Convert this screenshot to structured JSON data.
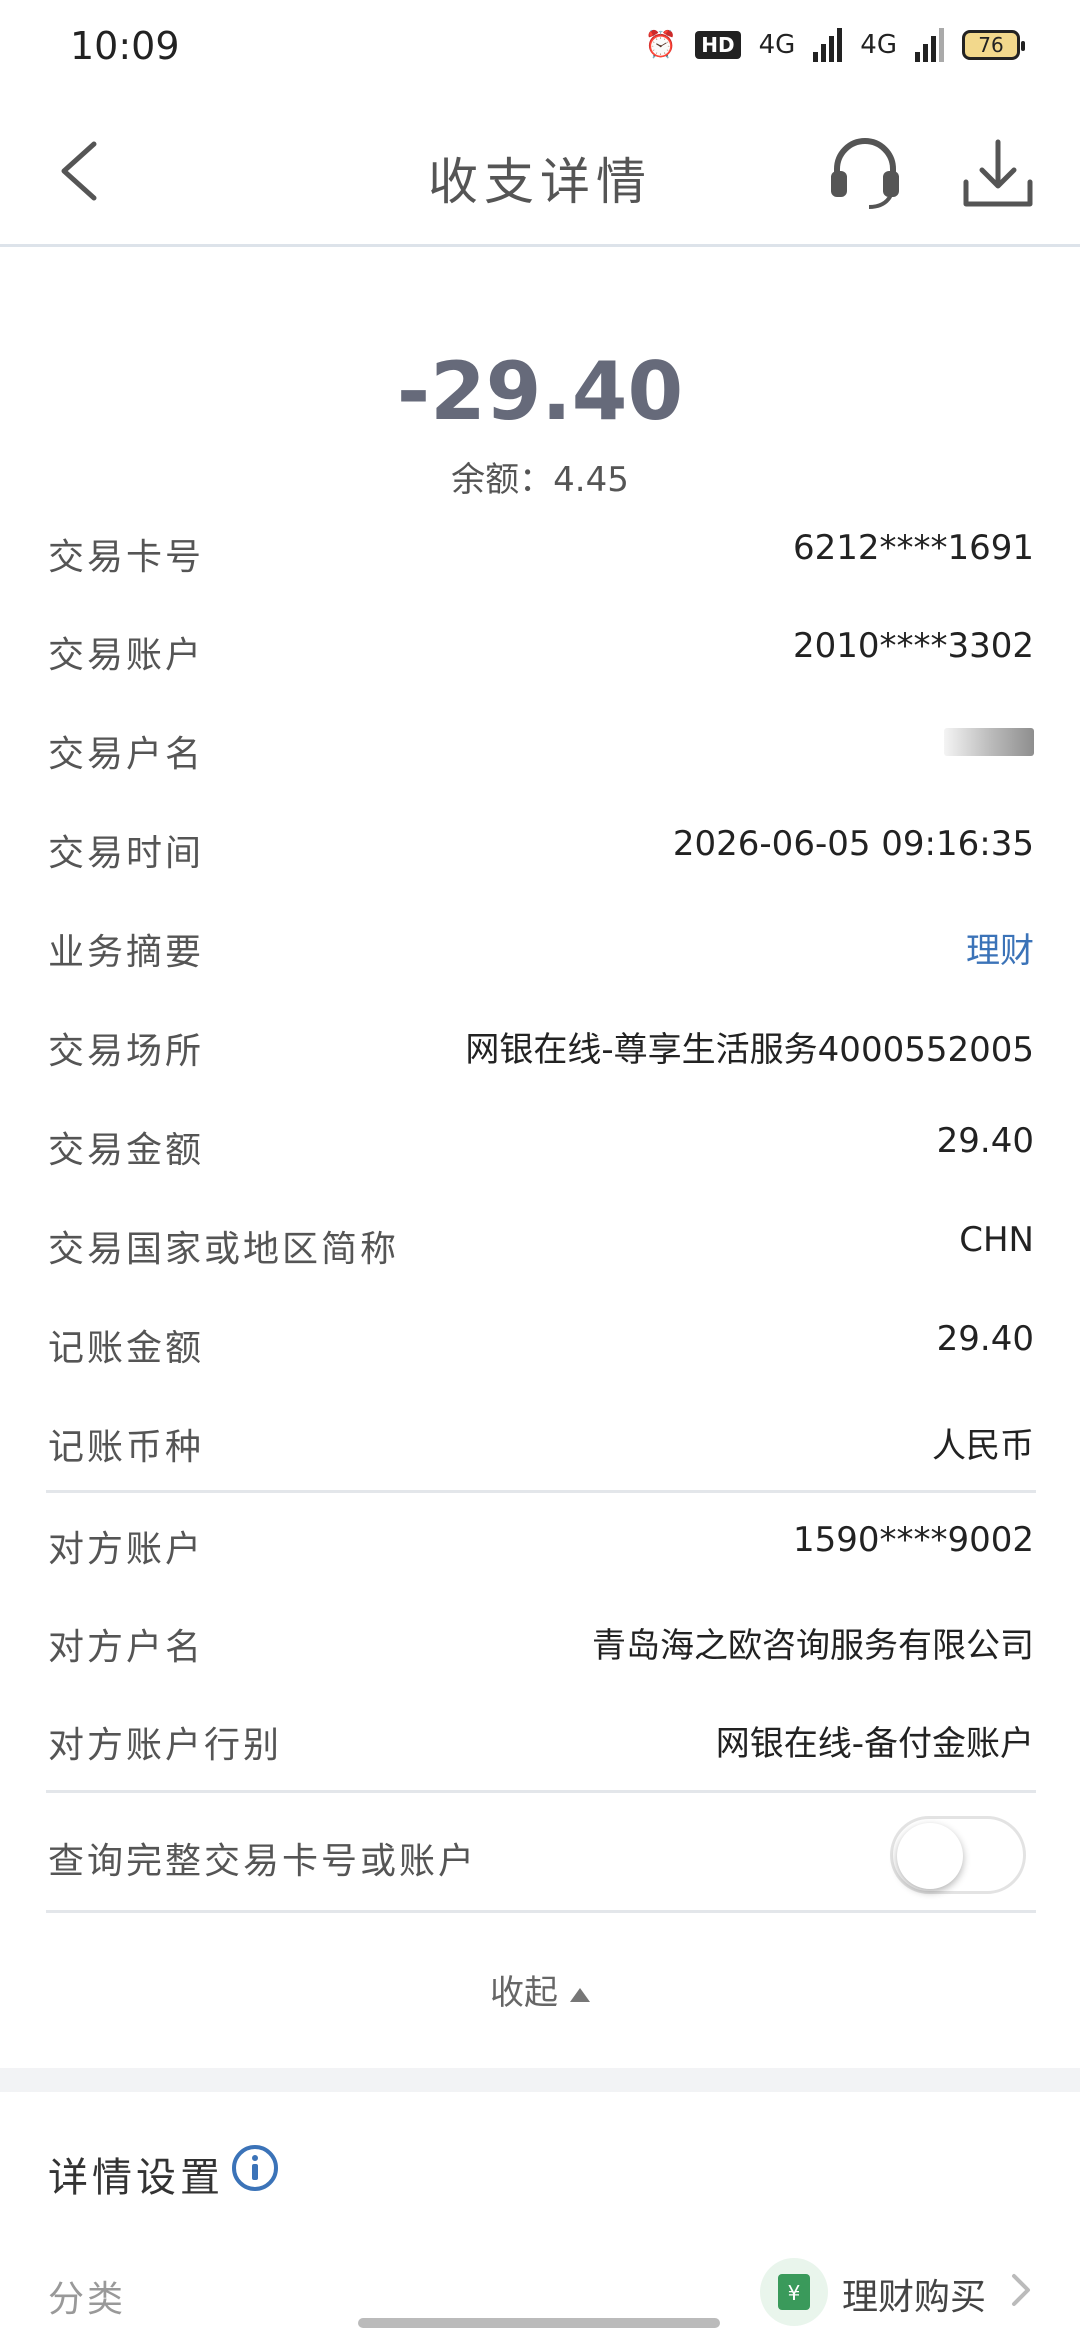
{
  "status": {
    "time": "10:09",
    "hd_label": "HD",
    "net1": "4G",
    "net2": "4G",
    "battery": "76"
  },
  "header": {
    "title": "收支详情"
  },
  "summary": {
    "amount": "-29.40",
    "balance": "余额：4.45"
  },
  "details": [
    {
      "label": "交易卡号",
      "value": "6212****1691"
    },
    {
      "label": "交易账户",
      "value": "2010****3302"
    },
    {
      "label": "交易户名",
      "value": ""
    },
    {
      "label": "交易时间",
      "value": "2026-06-05 09:16:35"
    },
    {
      "label": "业务摘要",
      "value": "理财"
    },
    {
      "label": "交易场所",
      "value": "网银在线-尊享生活服务4000552005"
    },
    {
      "label": "交易金额",
      "value": "29.40"
    },
    {
      "label": "交易国家或地区简称",
      "value": "CHN"
    },
    {
      "label": "记账金额",
      "value": "29.40"
    },
    {
      "label": "记账币种",
      "value": "人民币"
    }
  ],
  "counterparty": [
    {
      "label": "对方账户",
      "value": "1590****9002"
    },
    {
      "label": "对方户名",
      "value": "青岛海之欧咨询服务有限公司"
    },
    {
      "label": "对方账户行别",
      "value": "网银在线-备付金账户"
    }
  ],
  "toggle": {
    "label": "查询完整交易卡号或账户",
    "state": "off"
  },
  "collapse_label": "收起",
  "settings": {
    "title": "详情设置",
    "category_label": "分类",
    "category_value": "理财购买"
  }
}
